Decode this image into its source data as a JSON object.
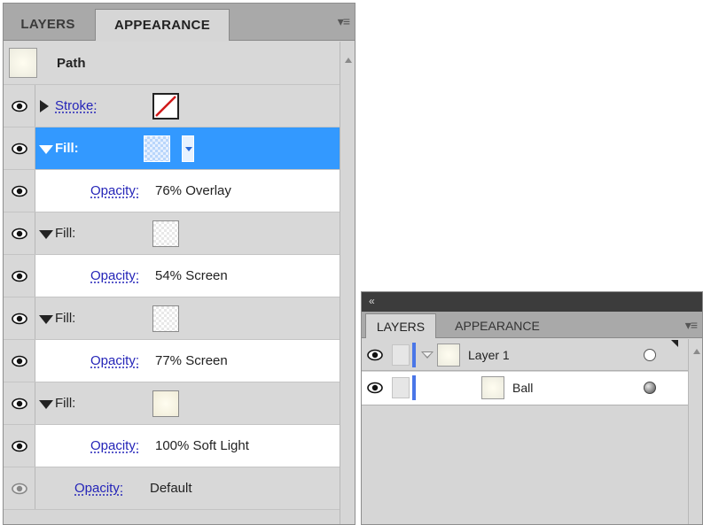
{
  "appearance_panel": {
    "tabs": [
      {
        "label": "LAYERS",
        "active": false
      },
      {
        "label": "APPEARANCE",
        "active": true
      }
    ],
    "menu_icon": "panel-menu-icon",
    "object_label": "Path",
    "rows": [
      {
        "type": "stroke",
        "label": "Stroke:",
        "expanded": false,
        "swatch": "none-swatch"
      },
      {
        "type": "fill",
        "label": "Fill:",
        "expanded": true,
        "selected": true,
        "swatch": "checker-swatch"
      },
      {
        "type": "opacity",
        "label": "Opacity:",
        "value": "76% Overlay"
      },
      {
        "type": "fill",
        "label": "Fill:",
        "expanded": true,
        "swatch": "checker-swatch"
      },
      {
        "type": "opacity",
        "label": "Opacity:",
        "value": "54% Screen"
      },
      {
        "type": "fill",
        "label": "Fill:",
        "expanded": true,
        "swatch": "checker-swatch"
      },
      {
        "type": "opacity",
        "label": "Opacity:",
        "value": "77% Screen"
      },
      {
        "type": "fill",
        "label": "Fill:",
        "expanded": true,
        "swatch": "cream-swatch"
      },
      {
        "type": "opacity",
        "label": "Opacity:",
        "value": "100% Soft Light"
      },
      {
        "type": "opacity-default",
        "label": "Opacity:",
        "value": "Default"
      }
    ],
    "colors": {
      "selection": "#3399ff",
      "link": "#2424b8",
      "panel_bg": "#d6d6d6"
    }
  },
  "layers_panel": {
    "collapse_icon": "«",
    "tabs": [
      {
        "label": "LAYERS",
        "active": true
      },
      {
        "label": "APPEARANCE",
        "active": false
      }
    ],
    "menu_icon": "panel-menu-icon",
    "layers": [
      {
        "name": "Layer 1",
        "expanded": true,
        "target": "hollow"
      },
      {
        "name": "Ball",
        "target": "filled",
        "indent": 1
      }
    ],
    "colors": {
      "layer_color": "#4a76e8"
    }
  }
}
